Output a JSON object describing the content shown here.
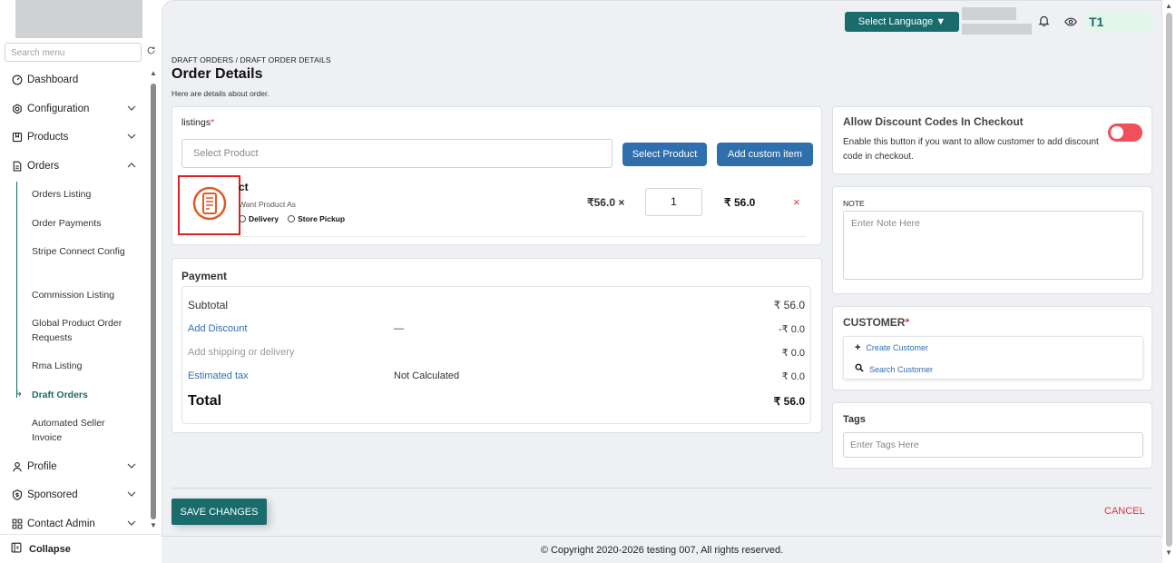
{
  "sidebar": {
    "search_placeholder": "Search menu",
    "items": [
      {
        "label": "Dashboard"
      },
      {
        "label": "Configuration"
      },
      {
        "label": "Products"
      },
      {
        "label": "Orders"
      },
      {
        "label": "Profile"
      },
      {
        "label": "Sponsored"
      },
      {
        "label": "Contact Admin"
      }
    ],
    "orders_sub": [
      "Orders Listing",
      "Order Payments",
      "Stripe Connect Config",
      "Commission Listing",
      "Global Product Order Requests",
      "Rma Listing",
      "Draft Orders",
      "Automated Seller Invoice"
    ],
    "collapse_label": "Collapse"
  },
  "header": {
    "language_button": "Select Language ▼",
    "avatar_text": "T1"
  },
  "page": {
    "breadcrumb": "DRAFT ORDERS / DRAFT ORDER DETAILS",
    "title": "Order Details",
    "subtitle": "Here are details about order."
  },
  "listings": {
    "label": "listings",
    "required_mark": "*",
    "select_placeholder": "Select Product",
    "select_product_btn": "Select Product",
    "add_custom_btn": "Add custom item",
    "product": {
      "name": "ct",
      "want_label": "Want Product As",
      "option_delivery": "Delivery",
      "option_pickup": "Store Pickup",
      "unit_price": "₹56.0 ×",
      "quantity": "1",
      "line_total": "₹ 56.0",
      "remove": "×"
    }
  },
  "payment": {
    "label": "Payment",
    "subtotal_label": "Subtotal",
    "subtotal_value": "₹ 56.0",
    "discount_label": "Add Discount",
    "discount_mid": "—",
    "discount_value": "-₹ 0.0",
    "shipping_label": "Add shipping or delivery",
    "shipping_value": "₹ 0.0",
    "tax_label": "Estimated tax",
    "tax_mid": "Not Calculated",
    "tax_value": "₹ 0.0",
    "total_label": "Total",
    "total_value": "₹ 56.0"
  },
  "discount_codes": {
    "title": "Allow Discount Codes In Checkout",
    "description": "Enable this button if you want to allow customer to add discount code in checkout.",
    "enabled": false
  },
  "note": {
    "label": "NOTE",
    "placeholder": "Enter Note Here"
  },
  "customer": {
    "label": "CUSTOMER",
    "required_mark": "*",
    "create": "Create Customer",
    "search": "Search Customer"
  },
  "tags": {
    "label": "Tags",
    "placeholder": "Enter Tags Here"
  },
  "actions": {
    "save": "SAVE CHANGES",
    "cancel": "CANCEL"
  },
  "footer": {
    "copyright": "© Copyright 2020-2026 testing 007, All rights reserved."
  },
  "colors": {
    "brand_teal": "#1a6b6b",
    "button_blue": "#2f6fad",
    "danger_red": "#e0343f"
  }
}
